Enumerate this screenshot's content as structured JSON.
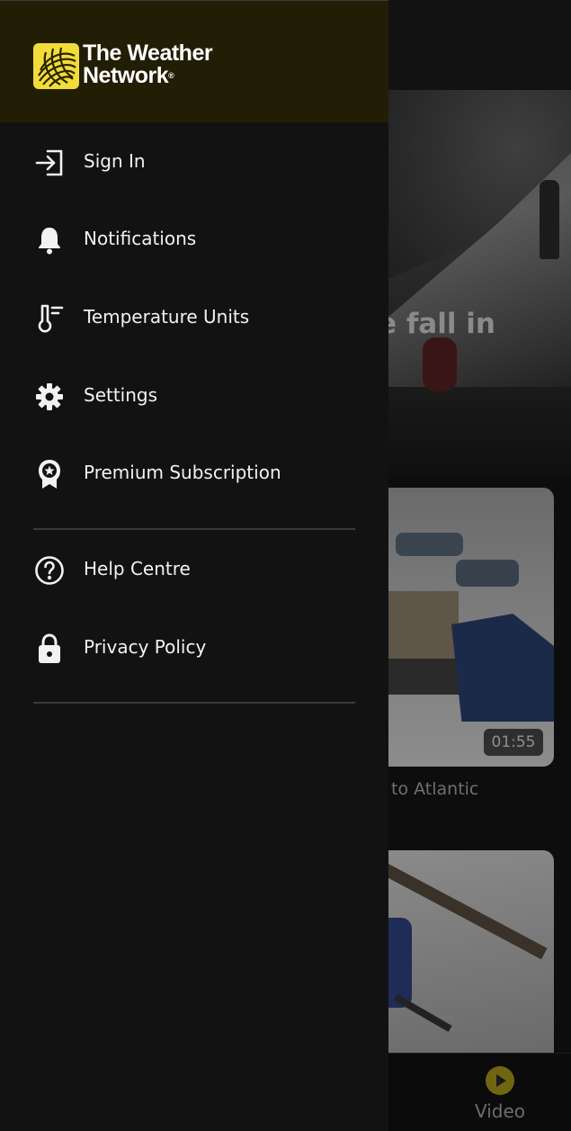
{
  "brand": {
    "name_line1": "The Weather",
    "name_line2": "Network",
    "registered_mark": "®",
    "logo_color": "#f2dc3a"
  },
  "menu": {
    "primary": [
      {
        "label": "Sign In",
        "icon": "sign-in-icon"
      },
      {
        "label": "Notifications",
        "icon": "bell-icon"
      },
      {
        "label": "Temperature Units",
        "icon": "thermometer-icon"
      },
      {
        "label": "Settings",
        "icon": "gear-icon"
      },
      {
        "label": "Premium Subscription",
        "icon": "award-ribbon-icon"
      }
    ],
    "secondary": [
      {
        "label": "Help Centre",
        "icon": "help-circle-icon"
      },
      {
        "label": "Privacy Policy",
        "icon": "lock-icon"
      }
    ]
  },
  "background": {
    "hero_title_fragment": "e fall in",
    "video_duration": "01:55",
    "video_caption_fragment": "to Atlantic",
    "bottom_nav_video_label": "Video"
  },
  "colors": {
    "drawer_bg": "#121212",
    "header_bg": "#221e05",
    "divider": "#3a3a3a",
    "text": "#f2f2f2"
  }
}
